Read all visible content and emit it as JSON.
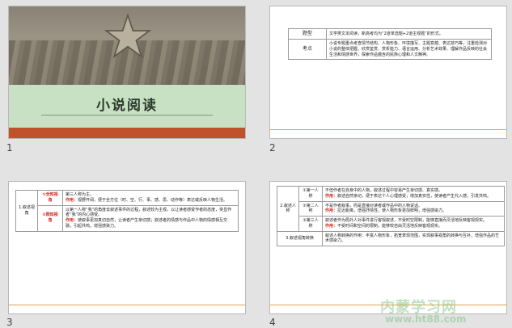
{
  "slides": [
    {
      "number": "1",
      "title": "小说阅读"
    },
    {
      "number": "2",
      "rows": [
        {
          "label": "题型",
          "text": "文学类文本阅读，新高考均为“2道单选题+2道主观题”的形式。"
        },
        {
          "label": "考点",
          "text": "小说专题重点考查情节结构、人物形象、环境描写、主题意蕴、表达技巧等，注重检测对小说的整体把握、欣赏鉴赏、赏析能力、语言运用、分析艺术效果、理解作品反映的社会生活和情感世界，探索作品蕴含的民族心理和人文精神。"
        }
      ]
    },
    {
      "number": "3",
      "group": "1.叙述视角",
      "rows": [
        {
          "sub": "①全知视角",
          "head": "第三人称为主。",
          "red": "作用：",
          "text": "视野开阔，便于全方位（时、空、行、事、感、思、动作等）表达或反映人物生活。"
        },
        {
          "sub": "②限知视角",
          "head": "以第一人称“我”的角度去叙述事件的过程，叙述较为主观，以让读者感受作者的态度，突显作者“我”的内心感受。",
          "red": "作用：",
          "text": "使叙事更加真切自然，让读者产生亲切感；叙述者的情感与作品中人物的情感相互交融，引起共鸣，增强感染力。"
        }
      ]
    },
    {
      "number": "4",
      "group": "2.叙述人称",
      "group2": "3.叙述视角转换",
      "rows": [
        {
          "sub": "①第一人称",
          "head": "不但作者在自身中的人物，叙述过程中容易产生亲切感、真实感。",
          "red": "作用：",
          "text": "叙述自然亲切，便于表达个人心理感受；增加真实性，使读者产生代入感，引发共鸣。"
        },
        {
          "sub": "②第二人称",
          "head": "不是作者叙事，而是直接对读者或作品中的人物说话。",
          "red": "作用：",
          "text": "拉近距离，增强抒情性，使人物形象更加鲜明，增强感染力。"
        },
        {
          "sub": "③第三人称",
          "head": "叙述者作为局外人对事件进行客观叙述，不受时空限制，能够直接而灵活地反映客观现实。",
          "red": "作用：",
          "text": "不受时间和空间的限制，能够较自由灵活地反映客观现实。"
        },
        {
          "sub": "",
          "head": "叙述人称转换的作用：丰富人物形象，拓宽表现范围，实现叙事视角的转换与互补，增强作品的艺术感染力。",
          "red": "",
          "text": ""
        }
      ]
    }
  ],
  "watermark": {
    "line1": "内蒙学习网",
    "line2": "www.ht88.com"
  }
}
